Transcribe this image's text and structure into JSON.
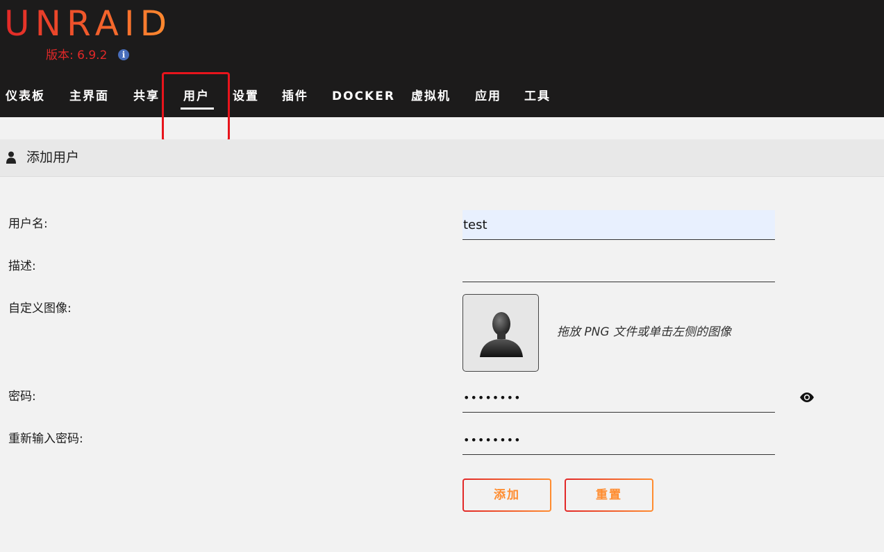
{
  "header": {
    "logo": "UNRAID",
    "version": "版本: 6.9.2",
    "info_icon": "i"
  },
  "nav": {
    "items": [
      {
        "label": "仪表板"
      },
      {
        "label": "主界面"
      },
      {
        "label": "共享"
      },
      {
        "label": "用户",
        "active": true
      },
      {
        "label": "设置"
      },
      {
        "label": "插件"
      },
      {
        "label": "DOCKER"
      },
      {
        "label": "虚拟机"
      },
      {
        "label": "应用"
      },
      {
        "label": "工具"
      }
    ]
  },
  "section": {
    "icon": "user-icon",
    "title": "添加用户"
  },
  "form": {
    "username_label": "用户名:",
    "username_value": "test",
    "description_label": "描述:",
    "description_value": "",
    "avatar_label": "自定义图像:",
    "avatar_hint": "拖放 PNG 文件或单击左侧的图像",
    "password_label": "密码:",
    "password_value": "••••••••",
    "confirm_label": "重新输入密码:",
    "confirm_value": "••••••••",
    "add_button": "添加",
    "reset_button": "重置"
  },
  "colors": {
    "header_bg": "#1c1b1b",
    "accent_start": "#e22828",
    "accent_end": "#ff8c2f",
    "highlight": "#e8141c"
  }
}
